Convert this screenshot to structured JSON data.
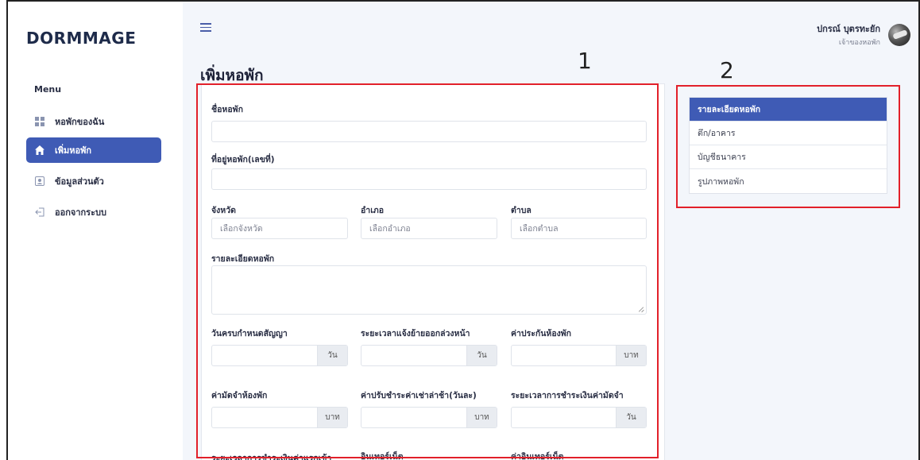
{
  "brand": "DORMMAGE",
  "sidebar": {
    "heading": "Menu",
    "items": [
      {
        "label": "หอพักของฉัน",
        "icon": "grid-icon",
        "active": false
      },
      {
        "label": "เพิ่มหอพัก",
        "icon": "home-icon",
        "active": true
      },
      {
        "label": "ข้อมูลส่วนตัว",
        "icon": "user-card-icon",
        "active": false
      },
      {
        "label": "ออกจากระบบ",
        "icon": "logout-icon",
        "active": false
      }
    ]
  },
  "user": {
    "name": "ปกรณ์ บุตรทะยัก",
    "role": "เจ้าของหอพัก"
  },
  "page_title": "เพิ่มหอพัก",
  "annotations": {
    "one": "1",
    "two": "2"
  },
  "form": {
    "dorm_name_label": "ชื่อหอพัก",
    "address_label": "ที่อยู่หอพัก(เลขที่)",
    "province_label": "จังหวัด",
    "province_placeholder": "เลือกจังหวัด",
    "district_label": "อำเภอ",
    "district_placeholder": "เลือกอำเภอ",
    "subdistrict_label": "ตำบล",
    "subdistrict_placeholder": "เลือกตำบล",
    "details_label": "รายละเอียดหอพัก",
    "contract_label": "วันครบกำหนดสัญญา",
    "contract_unit": "วัน",
    "notice_label": "ระยะเวลาแจ้งย้ายออกล่วงหน้า",
    "notice_unit": "วัน",
    "insurance_label": "ค่าประกันห้องพัก",
    "insurance_unit": "บาท",
    "deposit_label": "ค่ามัดจำห้องพัก",
    "deposit_unit": "บาท",
    "latefee_label": "ค่าปรับชำระค่าเช่าล่าช้า(วันละ)",
    "latefee_unit": "บาท",
    "deposit_period_label": "ระยะเวลาการชำระเงินค่ามัดจำ",
    "deposit_period_unit": "วัน",
    "first_payment_label": "ระยะเวลาการชำระเงินค่าแรกเข้า",
    "internet_label": "อินเทอร์เน็ต",
    "internet_fee_label": "ค่าอินเทอร์เน็ต"
  },
  "side_menu": [
    {
      "label": "รายละเอียดหอพัก",
      "active": true
    },
    {
      "label": "ตึก/อาคาร",
      "active": false
    },
    {
      "label": "บัญชีธนาคาร",
      "active": false
    },
    {
      "label": "รูปภาพหอพัก",
      "active": false
    }
  ],
  "colors": {
    "accent": "#3f5bb5",
    "annotation": "#e2202a",
    "background": "#f3f6fb"
  }
}
